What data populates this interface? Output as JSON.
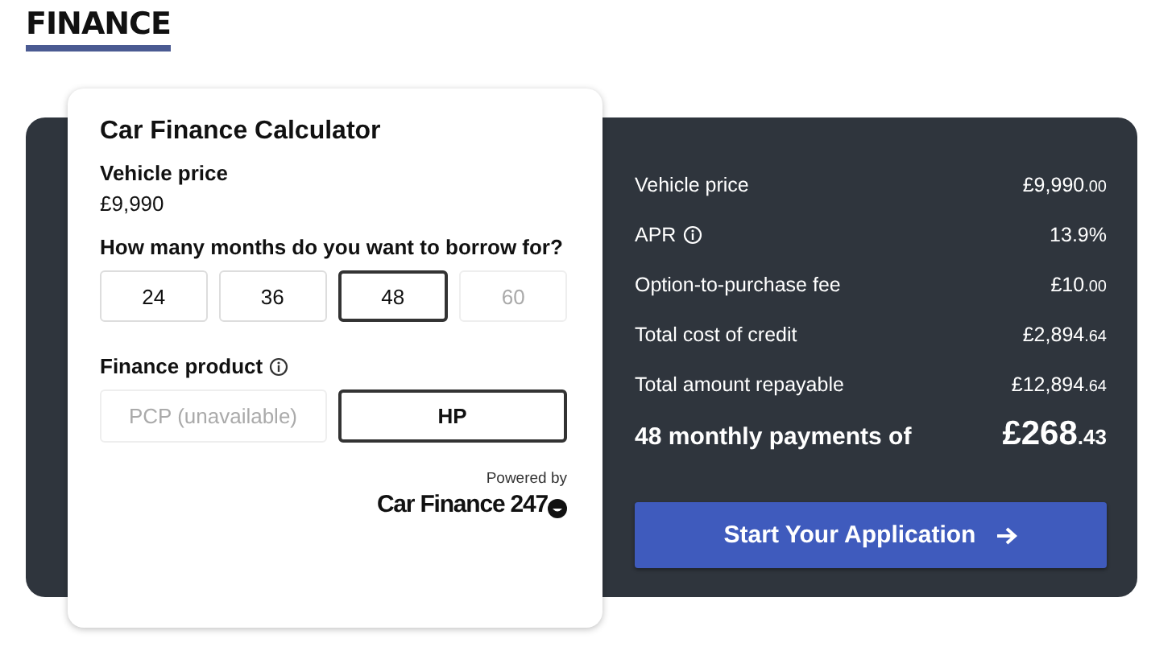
{
  "heading": "FINANCE",
  "calculator": {
    "title": "Car Finance Calculator",
    "price_label": "Vehicle price",
    "price": "£9,990",
    "months_question": "How many months do you want to borrow for?",
    "months": [
      {
        "label": "24",
        "selected": false,
        "disabled": false
      },
      {
        "label": "36",
        "selected": false,
        "disabled": false
      },
      {
        "label": "48",
        "selected": true,
        "disabled": false
      },
      {
        "label": "60",
        "selected": false,
        "disabled": true
      }
    ],
    "product_label": "Finance product",
    "products": [
      {
        "label": "PCP (unavailable)",
        "selected": false,
        "disabled": true
      },
      {
        "label": "HP",
        "selected": true,
        "disabled": false
      }
    ],
    "powered_by": "Powered by",
    "brand": "Car Finance 247"
  },
  "summary": {
    "rows": [
      {
        "label": "Vehicle price",
        "info": false,
        "amount": "£9,990",
        "pence": ".00"
      },
      {
        "label": "APR",
        "info": true,
        "amount": "13.9%"
      },
      {
        "label": "Option-to-purchase fee",
        "info": false,
        "amount": "£10",
        "pence": ".00"
      },
      {
        "label": "Total cost of credit",
        "info": false,
        "amount": "£2,894",
        "pence": ".64"
      },
      {
        "label": "Total amount repayable",
        "info": false,
        "amount": "£12,894",
        "pence": ".64"
      }
    ],
    "monthly_label": "48 monthly payments of",
    "monthly_amount": "£268",
    "monthly_pence": ".43",
    "button": "Start Your Application"
  }
}
